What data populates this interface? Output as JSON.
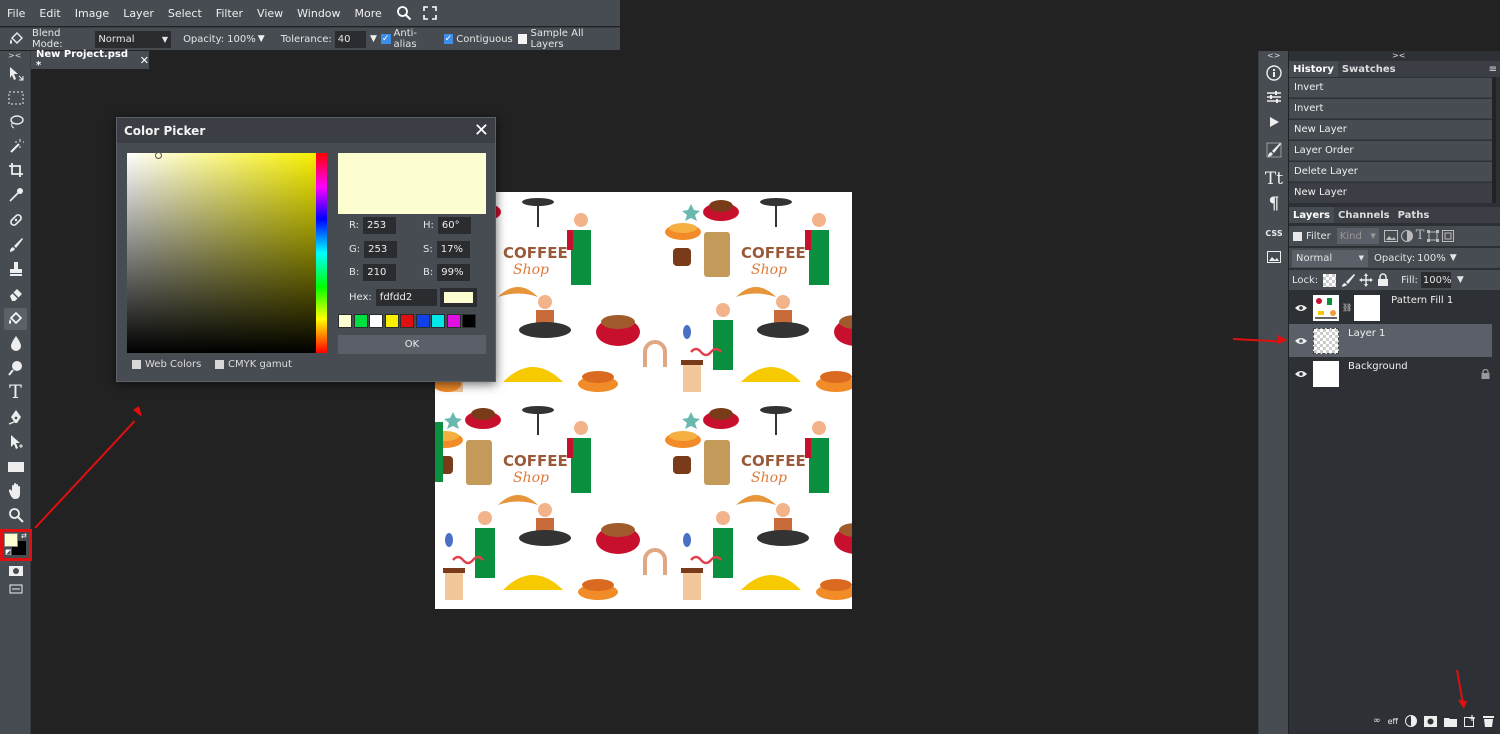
{
  "menubar": {
    "items": [
      "File",
      "Edit",
      "Image",
      "Layer",
      "Select",
      "Filter",
      "View",
      "Window",
      "More"
    ],
    "icons": [
      "search-icon",
      "fullscreen-icon"
    ]
  },
  "options": {
    "blend_label": "Blend Mode:",
    "blend_value": "Normal",
    "opacity_label": "Opacity:",
    "opacity_value": "100%",
    "tolerance_label": "Tolerance:",
    "tolerance_value": "40",
    "antialias_label": "Anti-alias",
    "contiguous_label": "Contiguous",
    "sample_label": "Sample All Layers"
  },
  "document": {
    "tab_label": "New Project.psd *"
  },
  "picker": {
    "title": "Color Picker",
    "r_label": "R:",
    "r": "253",
    "g_label": "G:",
    "g": "253",
    "b_label": "B:",
    "b": "210",
    "h_label": "H:",
    "h": "60°",
    "s_label": "S:",
    "s": "17%",
    "v_label": "B:",
    "v": "99%",
    "hex_label": "Hex:",
    "hex": "fdfdd2",
    "ok_label": "OK",
    "web_colors": "Web Colors",
    "cmyk": "CMYK gamut",
    "current_color": "#fdfdd2",
    "swatches": [
      "#fdfdd2",
      "#00e040",
      "#ffffff",
      "#f8f000",
      "#e01010",
      "#1040e8",
      "#00e8e8",
      "#e010e0",
      "#000000"
    ]
  },
  "history": {
    "tabs": [
      "History",
      "Swatches"
    ],
    "items": [
      "Invert",
      "Invert",
      "New Layer",
      "Layer Order",
      "Delete Layer",
      "New Layer"
    ]
  },
  "layers": {
    "tabs": [
      "Layers",
      "Channels",
      "Paths"
    ],
    "filter_label": "Filter",
    "kind_label": "Kind",
    "blend": "Normal",
    "opacity_label": "Opacity:",
    "opacity": "100%",
    "lock_label": "Lock:",
    "fill_label": "Fill:",
    "fill": "100%",
    "items": [
      {
        "name": "Pattern Fill 1"
      },
      {
        "name": "Layer 1"
      },
      {
        "name": "Background"
      }
    ]
  },
  "right_icons": [
    "info-icon",
    "adjust-icon",
    "play-icon",
    "brush-settings-icon",
    "character-icon",
    "paragraph-icon",
    "css-icon",
    "image-icon"
  ],
  "colors": {
    "foreground": "#fdfdd2",
    "background": "#000000",
    "highlight": "#e01010"
  },
  "canvas": {
    "coffee_text_1": "COFFEE",
    "coffee_text_2": "Shop"
  }
}
